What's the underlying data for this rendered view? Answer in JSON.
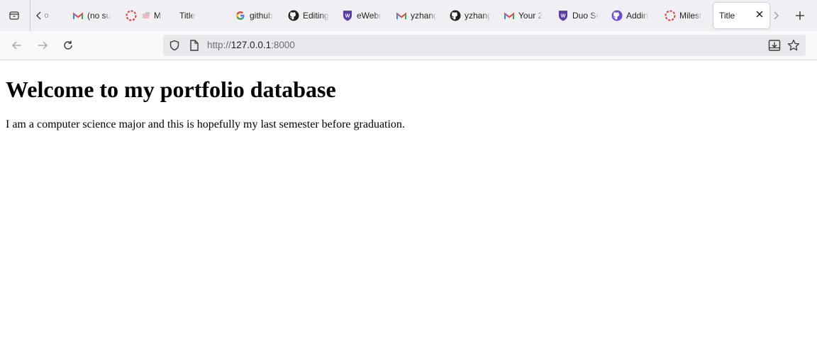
{
  "browser": {
    "tabs": [
      {
        "label": "(no su",
        "icon": "gmail-icon"
      },
      {
        "label": "M",
        "icon": "loading-icon"
      },
      {
        "label": "Title",
        "icon": "none"
      },
      {
        "label": "github",
        "icon": "google-icon"
      },
      {
        "label": "Editing",
        "icon": "github-icon"
      },
      {
        "label": "eWebr",
        "icon": "shield-w-icon"
      },
      {
        "label": "yzhang",
        "icon": "gmail-icon"
      },
      {
        "label": "yzhang",
        "icon": "github-icon"
      },
      {
        "label": "Your 2",
        "icon": "gmail-icon"
      },
      {
        "label": "Duo Se",
        "icon": "shield-w-icon"
      },
      {
        "label": "Addin",
        "icon": "github-icon"
      },
      {
        "label": "Milest",
        "icon": "loading-icon"
      },
      {
        "label": "Title",
        "icon": "none",
        "active": true
      }
    ],
    "overflow_left_label": "o",
    "address": {
      "protocol": "http://",
      "host": "127.0.0.1",
      "port": ":8000"
    },
    "colors": {
      "tabstrip": "#f0f0f4",
      "navbar": "#f9f9fb",
      "urlbar": "#e9e9ed",
      "gmail_red": "#ea4335",
      "wisc_purple": "#5b3fa8",
      "github_purple": "#6a4bd8"
    }
  },
  "page": {
    "heading": "Welcome to my portfolio database",
    "paragraph": "I am a computer science major and this is hopefully my last semester before graduation."
  }
}
